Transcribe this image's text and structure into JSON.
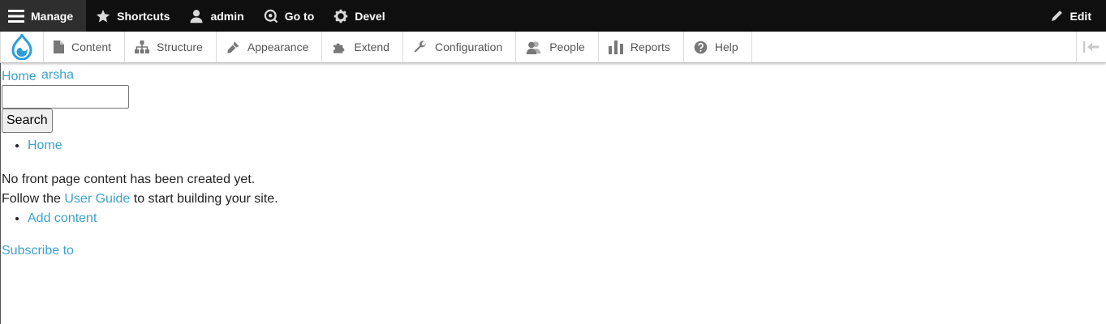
{
  "toolbar": {
    "manage": "Manage",
    "shortcuts": "Shortcuts",
    "user": "admin",
    "goto": "Go to",
    "devel": "Devel",
    "edit": "Edit"
  },
  "admin_menu": {
    "items": [
      {
        "label": "Content",
        "icon": "file-icon"
      },
      {
        "label": "Structure",
        "icon": "sitemap-icon"
      },
      {
        "label": "Appearance",
        "icon": "paintbrush-icon"
      },
      {
        "label": "Extend",
        "icon": "puzzle-icon"
      },
      {
        "label": "Configuration",
        "icon": "wrench-icon"
      },
      {
        "label": "People",
        "icon": "people-icon"
      },
      {
        "label": "Reports",
        "icon": "bar-chart-icon"
      },
      {
        "label": "Help",
        "icon": "help-icon"
      }
    ]
  },
  "branding": {
    "home_link": "Home",
    "site_name": "arsha"
  },
  "search": {
    "value": "",
    "button": "Search"
  },
  "main_nav": [
    "Home"
  ],
  "front_page": {
    "empty_line": "No front page content has been created yet.",
    "follow_prefix": "Follow the ",
    "guide_link": "User Guide",
    "follow_suffix": " to start building your site.",
    "add_content": "Add content"
  },
  "feed": {
    "subscribe": "Subscribe to"
  },
  "colors": {
    "toolbar_bg": "#0f0f0f",
    "link": "#3ba3cc",
    "drupal_blue": "#2a9fd8"
  }
}
